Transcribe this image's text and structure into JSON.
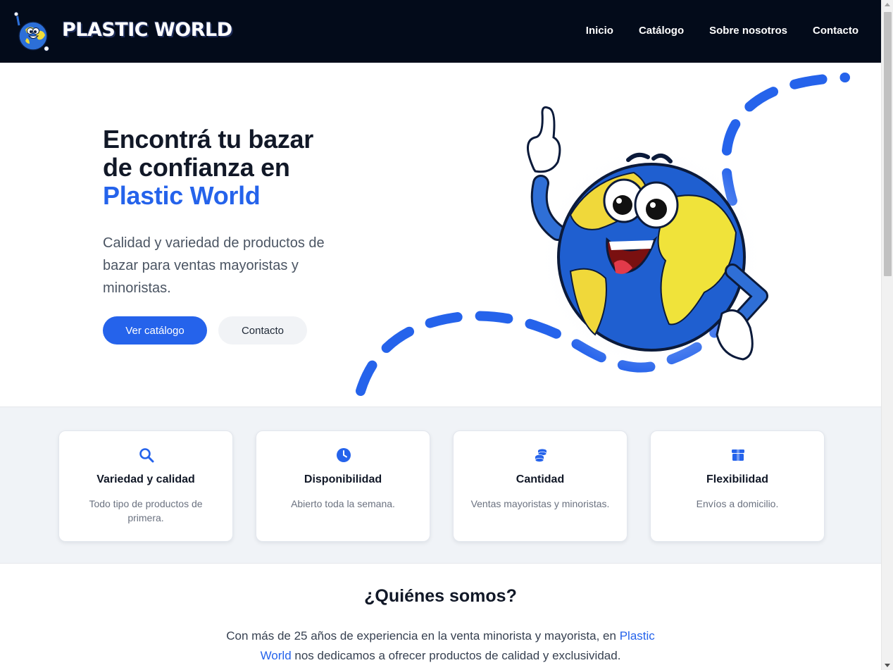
{
  "header": {
    "brand": "PLASTIC WORLD",
    "nav": [
      "Inicio",
      "Catálogo",
      "Sobre nosotros",
      "Contacto"
    ]
  },
  "hero": {
    "title_line1": "Encontrá tu bazar",
    "title_line2": "de confianza en",
    "title_accent": "Plastic World",
    "subtitle": "Calidad y variedad de productos de bazar para ventas mayoristas y minoristas.",
    "primary_button": "Ver catálogo",
    "secondary_button": "Contacto"
  },
  "features": [
    {
      "icon": "search-icon",
      "title": "Variedad y calidad",
      "text": "Todo tipo de productos de primera."
    },
    {
      "icon": "clock-icon",
      "title": "Disponibilidad",
      "text": "Abierto toda la semana."
    },
    {
      "icon": "coins-icon",
      "title": "Cantidad",
      "text": "Ventas mayoristas y minoristas."
    },
    {
      "icon": "box-icon",
      "title": "Flexibilidad",
      "text": "Envíos a domicilio."
    }
  ],
  "about": {
    "title": "¿Quiénes somos?",
    "text_before": "Con más de 25 años de experiencia en la venta minorista y mayorista, en",
    "text_accent": "Plastic World",
    "text_after": "nos dedicamos a ofrecer productos de calidad y exclusividad."
  },
  "colors": {
    "accent": "#2563eb",
    "header_bg": "#030b1a",
    "features_bg": "#f0f3f7"
  }
}
